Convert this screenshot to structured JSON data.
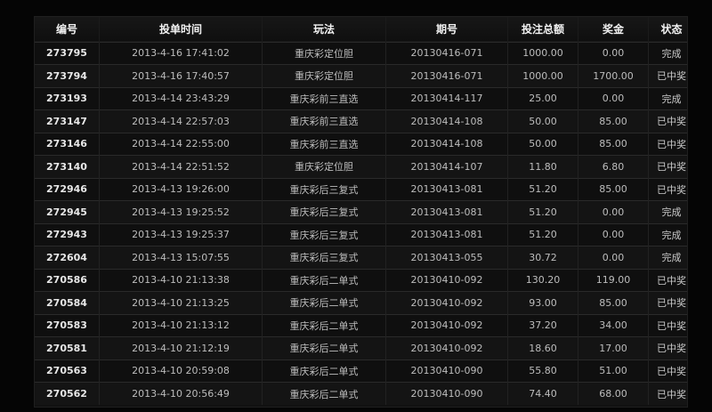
{
  "table": {
    "headers": [
      "编号",
      "投单时间",
      "玩法",
      "期号",
      "投注总额",
      "奖金",
      "状态"
    ],
    "rows": [
      [
        "273795",
        "2013-4-16 17:41:02",
        "重庆彩定位胆",
        "20130416-071",
        "1000.00",
        "0.00",
        "完成"
      ],
      [
        "273794",
        "2013-4-16 17:40:57",
        "重庆彩定位胆",
        "20130416-071",
        "1000.00",
        "1700.00",
        "已中奖"
      ],
      [
        "273193",
        "2013-4-14 23:43:29",
        "重庆彩前三直选",
        "20130414-117",
        "25.00",
        "0.00",
        "完成"
      ],
      [
        "273147",
        "2013-4-14 22:57:03",
        "重庆彩前三直选",
        "20130414-108",
        "50.00",
        "85.00",
        "已中奖"
      ],
      [
        "273146",
        "2013-4-14 22:55:00",
        "重庆彩前三直选",
        "20130414-108",
        "50.00",
        "85.00",
        "已中奖"
      ],
      [
        "273140",
        "2013-4-14 22:51:52",
        "重庆彩定位胆",
        "20130414-107",
        "11.80",
        "6.80",
        "已中奖"
      ],
      [
        "272946",
        "2013-4-13 19:26:00",
        "重庆彩后三复式",
        "20130413-081",
        "51.20",
        "85.00",
        "已中奖"
      ],
      [
        "272945",
        "2013-4-13 19:25:52",
        "重庆彩后三复式",
        "20130413-081",
        "51.20",
        "0.00",
        "完成"
      ],
      [
        "272943",
        "2013-4-13 19:25:37",
        "重庆彩后三复式",
        "20130413-081",
        "51.20",
        "0.00",
        "完成"
      ],
      [
        "272604",
        "2013-4-13 15:07:55",
        "重庆彩后三复式",
        "20130413-055",
        "30.72",
        "0.00",
        "完成"
      ],
      [
        "270586",
        "2013-4-10 21:13:38",
        "重庆彩后二单式",
        "20130410-092",
        "130.20",
        "119.00",
        "已中奖"
      ],
      [
        "270584",
        "2013-4-10 21:13:25",
        "重庆彩后二单式",
        "20130410-092",
        "93.00",
        "85.00",
        "已中奖"
      ],
      [
        "270583",
        "2013-4-10 21:13:12",
        "重庆彩后二单式",
        "20130410-092",
        "37.20",
        "34.00",
        "已中奖"
      ],
      [
        "270581",
        "2013-4-10 21:12:19",
        "重庆彩后二单式",
        "20130410-092",
        "18.60",
        "17.00",
        "已中奖"
      ],
      [
        "270563",
        "2013-4-10 20:59:08",
        "重庆彩后二单式",
        "20130410-090",
        "55.80",
        "51.00",
        "已中奖"
      ],
      [
        "270562",
        "2013-4-10 20:56:49",
        "重庆彩后二单式",
        "20130410-090",
        "74.40",
        "68.00",
        "已中奖"
      ]
    ]
  },
  "colors": {
    "background": "#050505",
    "panel": "#111111",
    "header_border": "#5b2a1a",
    "text": "#bdbdbd",
    "header_text": "#f2f2f2"
  }
}
